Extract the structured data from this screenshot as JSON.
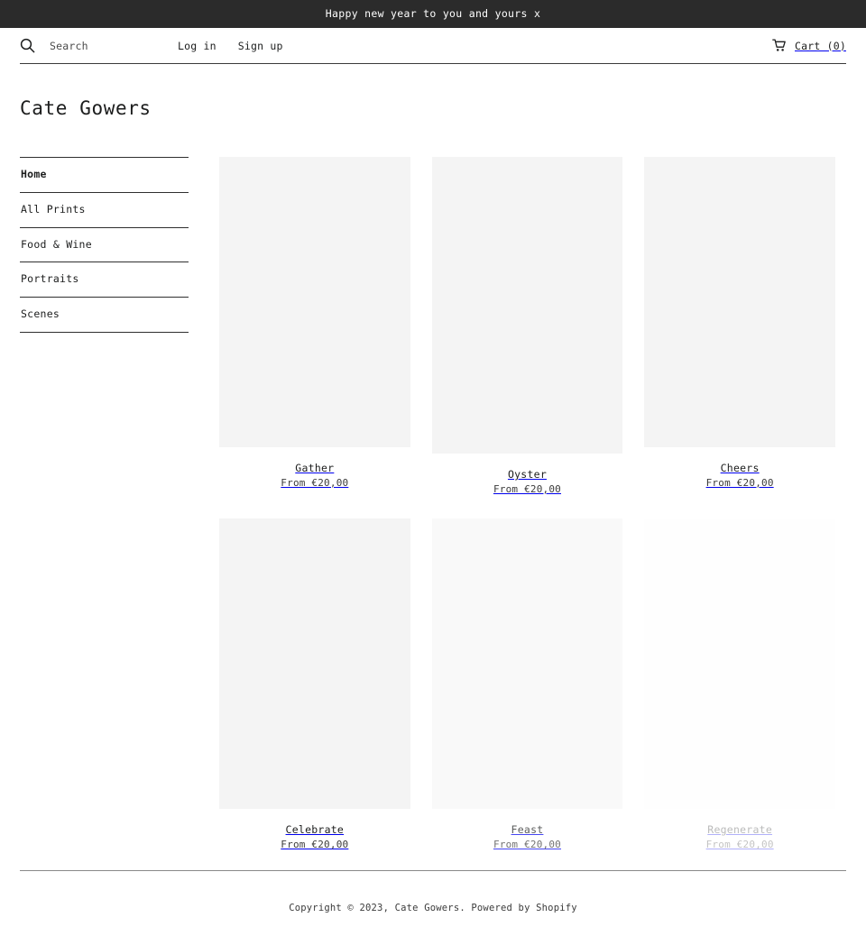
{
  "announcement": {
    "text": "Happy new year to you and yours x"
  },
  "header": {
    "search": {
      "icon": "search-icon",
      "placeholder": "Search",
      "value": ""
    },
    "nav": [
      {
        "label": "Log in"
      },
      {
        "label": "Sign up"
      }
    ],
    "cart": {
      "icon": "shopping-cart-icon",
      "label": "Cart (0)",
      "count": 0
    }
  },
  "site": {
    "title": "Cate Gowers"
  },
  "sidebar": {
    "items": [
      {
        "label": "Home",
        "active": true
      },
      {
        "label": "All Prints",
        "active": false
      },
      {
        "label": "Food & Wine",
        "active": false
      },
      {
        "label": "Portraits",
        "active": false
      },
      {
        "label": "Scenes",
        "active": false
      }
    ]
  },
  "products": [
    {
      "title": "Gather",
      "price": "From €20,00",
      "state": "loaded"
    },
    {
      "title": "Oyster",
      "price": "From €20,00",
      "state": "loaded"
    },
    {
      "title": "Cheers",
      "price": "From €20,00",
      "state": "loaded"
    },
    {
      "title": "Celebrate",
      "price": "From €20,00",
      "state": "loaded"
    },
    {
      "title": "Feast",
      "price": "From €20,00",
      "state": "fading"
    },
    {
      "title": "Regenerate",
      "price": "From €20,00",
      "state": "loading"
    }
  ],
  "footer": {
    "copyright": "Copyright © 2023, Cate Gowers. Powered by Shopify"
  },
  "colors": {
    "announcement_bg": "#2b2b2b",
    "announcement_text": "#ffffff",
    "page_bg": "#ffffff",
    "text": "#1c1d1d",
    "muted_text": "#3b3b3b",
    "rule": "#2f2f2f",
    "footer_rule": "#8a8a8a",
    "placeholder_bg": "#f4f4f4"
  }
}
